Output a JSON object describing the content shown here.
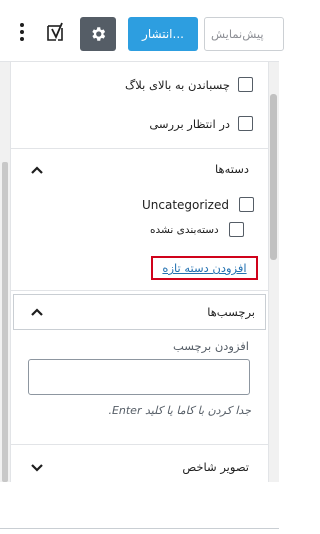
{
  "toolbar": {
    "preview_label": "پیش‌نمایش",
    "publish_label": "انتشار...",
    "settings_icon": "gear-icon",
    "yoast_icon": "yoast-seo-icon",
    "more_icon": "vertical-ellipsis-icon"
  },
  "status": {
    "sticky_label": "چسباندن به بالای بلاگ",
    "pending_label": "در انتظار بررسی"
  },
  "categories": {
    "title": "دسته‌ها",
    "items": [
      {
        "label": "Uncategorized"
      },
      {
        "label": "دسته‌بندی نشده"
      }
    ],
    "add_new_label": "افزودن دسته تازه"
  },
  "tags": {
    "title": "برچسب‌ها",
    "add_label": "افزودن برچسب",
    "help_text": "جدا کردن با کاما یا کلید Enter."
  },
  "featured_image": {
    "title": "تصویر شاخص"
  },
  "colors": {
    "publish": "#2d9ee0",
    "settings": "#555d66",
    "link": "#2271b1",
    "highlight": "#d0021b"
  }
}
